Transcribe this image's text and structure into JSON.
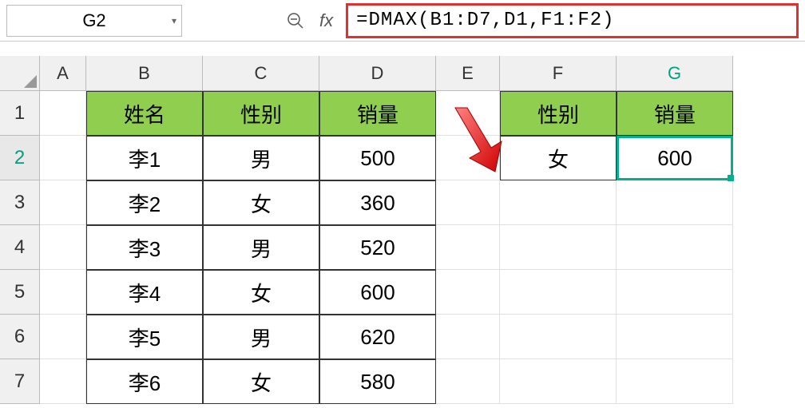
{
  "nameBox": "G2",
  "formula": "=DMAX(B1:D7,D1,F1:F2)",
  "fxLabel": "fx",
  "columns": [
    "A",
    "B",
    "C",
    "D",
    "E",
    "F",
    "G"
  ],
  "rows": [
    "1",
    "2",
    "3",
    "4",
    "5",
    "6",
    "7"
  ],
  "activeCol": "G",
  "activeRow": "2",
  "mainTable": {
    "headers": [
      "姓名",
      "性别",
      "销量"
    ],
    "rows": [
      [
        "李1",
        "男",
        "500"
      ],
      [
        "李2",
        "女",
        "360"
      ],
      [
        "李3",
        "男",
        "520"
      ],
      [
        "李4",
        "女",
        "600"
      ],
      [
        "李5",
        "男",
        "620"
      ],
      [
        "李6",
        "女",
        "580"
      ]
    ]
  },
  "criteria": {
    "headers": [
      "性别",
      "销量"
    ],
    "row": [
      "女",
      "600"
    ]
  },
  "colors": {
    "headerFill": "#8fce4e",
    "highlightBox": "#e03030",
    "selection": "#00b090"
  },
  "chart_data": {
    "type": "table",
    "title": "DMAX function example",
    "series": [
      {
        "name": "姓名",
        "values": [
          "李1",
          "李2",
          "李3",
          "李4",
          "李5",
          "李6"
        ]
      },
      {
        "name": "性别",
        "values": [
          "男",
          "女",
          "男",
          "女",
          "男",
          "女"
        ]
      },
      {
        "name": "销量",
        "values": [
          500,
          360,
          520,
          600,
          620,
          580
        ]
      }
    ],
    "criteria": {
      "性别": "女"
    },
    "result": 600
  }
}
